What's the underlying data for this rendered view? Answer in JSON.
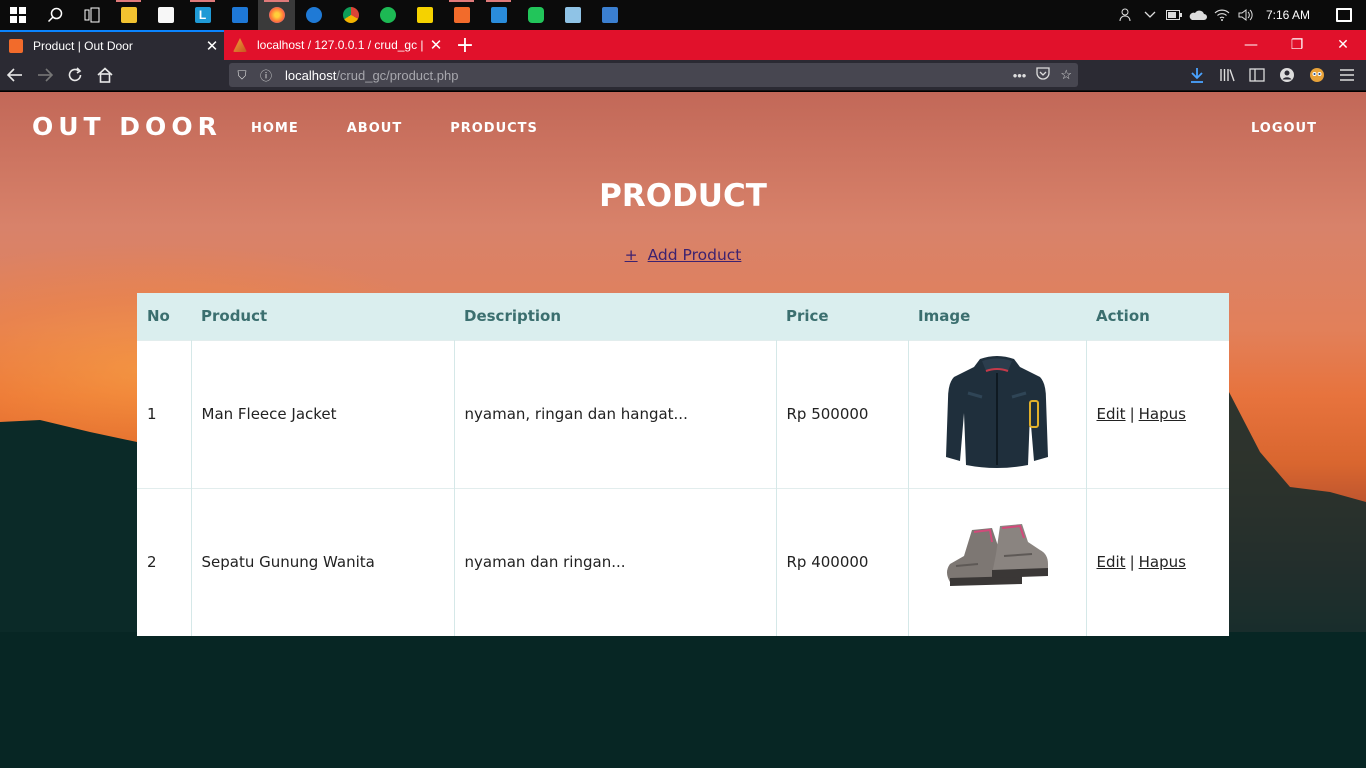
{
  "taskbar": {
    "apps": [
      {
        "icon": "search-icon"
      },
      {
        "icon": "task-view-icon"
      },
      {
        "icon": "file-explorer-icon",
        "color": "#f2c230"
      },
      {
        "icon": "store-icon",
        "color": "#f7f7f7"
      },
      {
        "icon": "app-l-icon",
        "color": "#1f9ad6"
      },
      {
        "icon": "mail-icon",
        "color": "#1e78d7"
      },
      {
        "icon": "firefox-icon",
        "color": "#ff7139"
      },
      {
        "icon": "edge-icon",
        "color": "#1f7ad6"
      },
      {
        "icon": "chrome-icon",
        "color": "#e5a52b"
      },
      {
        "icon": "spotify-icon",
        "color": "#1db954"
      },
      {
        "icon": "sticky-notes-icon",
        "color": "#f5d200"
      },
      {
        "icon": "xampp-icon",
        "color": "#f26b2b"
      },
      {
        "icon": "vscode-icon",
        "color": "#2a8cdb"
      },
      {
        "icon": "line-icon",
        "color": "#22c55a"
      },
      {
        "icon": "notepad-icon",
        "color": "#8fc3e6"
      },
      {
        "icon": "photos-icon",
        "color": "#3b7fd0"
      }
    ],
    "clock": "7:16 AM"
  },
  "browser": {
    "tabs": [
      {
        "title": "Product | Out Door",
        "active": true,
        "favicon_color": "#f26b2b"
      },
      {
        "title": "localhost / 127.0.0.1 / crud_gc |",
        "active": false,
        "favicon_color": "#f3a23a"
      }
    ],
    "url_host": "localhost",
    "url_path": "/crud_gc/product.php",
    "accent": "#e1112b"
  },
  "site": {
    "brand": "OUT DOOR",
    "menu": [
      "HOME",
      "ABOUT",
      "PRODUCTS"
    ],
    "logout": "LOGOUT",
    "title": "PRODUCT",
    "add_plus": "+",
    "add_label": "Add Product"
  },
  "table": {
    "headers": [
      "No",
      "Product",
      "Description",
      "Price",
      "Image",
      "Action"
    ],
    "rows": [
      {
        "no": "1",
        "product": "Man Fleece Jacket",
        "description": "nyaman, ringan dan hangat...",
        "price": "Rp 500000",
        "image": "jacket-image",
        "edit": "Edit",
        "sep": "|",
        "delete": "Hapus"
      },
      {
        "no": "2",
        "product": "Sepatu Gunung Wanita",
        "description": "nyaman dan ringan...",
        "price": "Rp 400000",
        "image": "hiking-shoes-image",
        "edit": "Edit",
        "sep": "|",
        "delete": "Hapus"
      }
    ]
  }
}
